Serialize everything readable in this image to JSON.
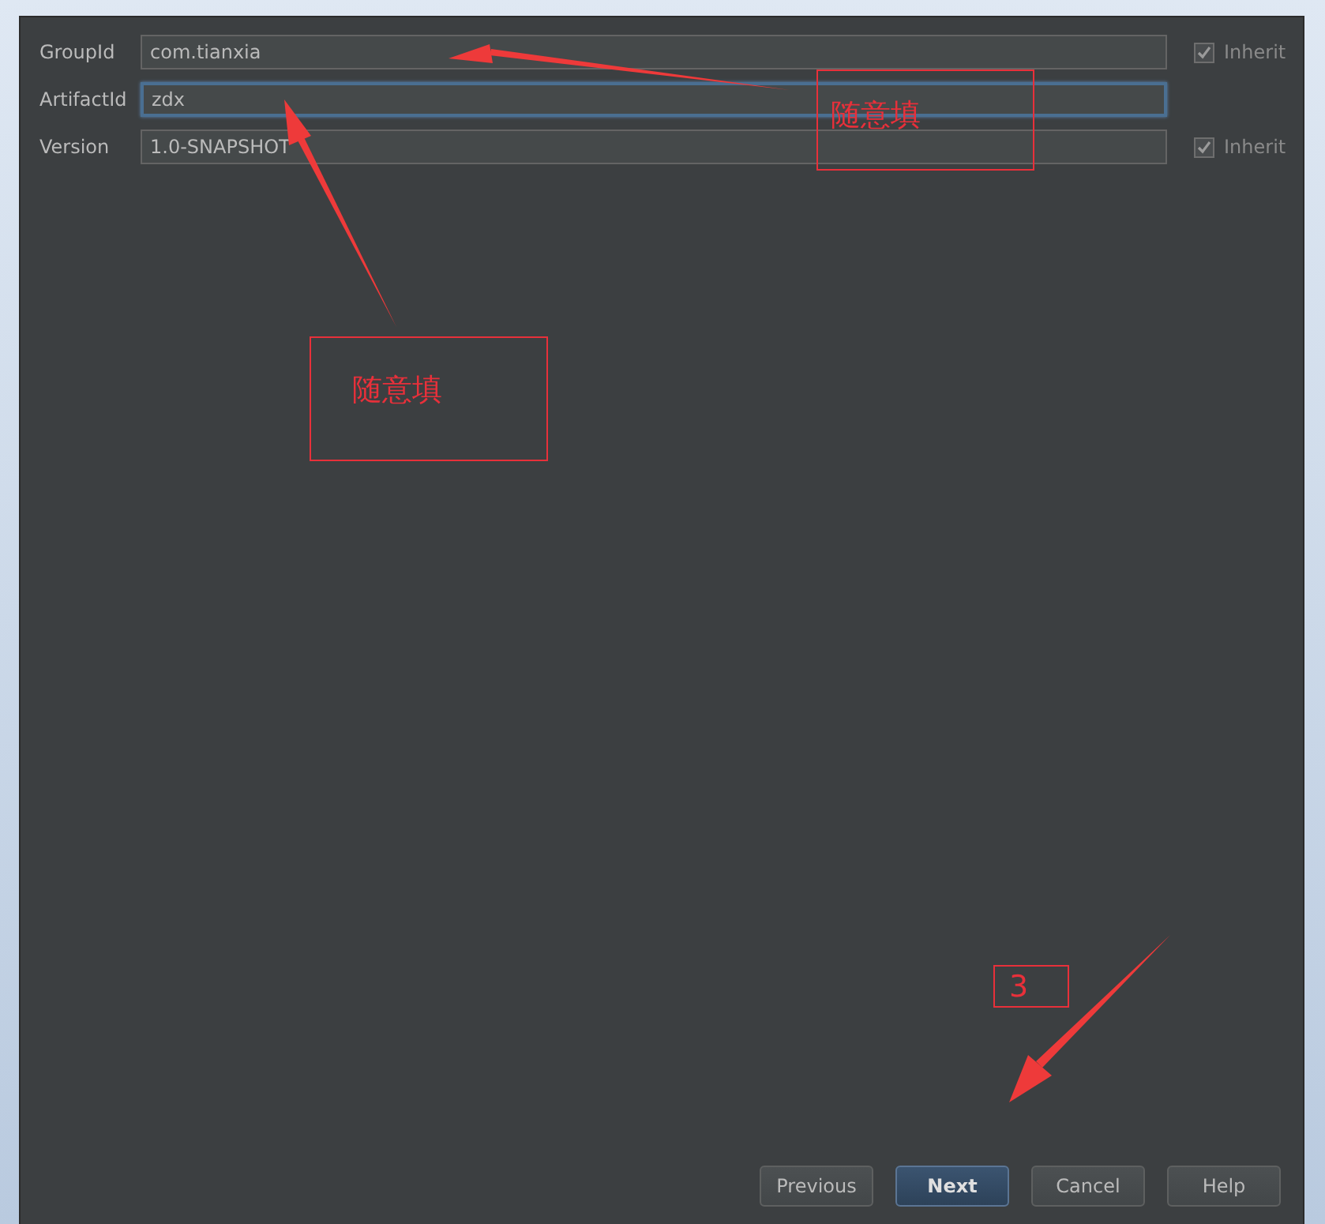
{
  "fields": [
    {
      "label": "GroupId",
      "value": "com.tianxia",
      "focused": false,
      "inherit": {
        "label": "Inherit",
        "checked": true
      }
    },
    {
      "label": "ArtifactId",
      "value": "zdx",
      "focused": true
    },
    {
      "label": "Version",
      "value": "1.0-SNAPSHOT",
      "focused": false,
      "inherit": {
        "label": "Inherit",
        "checked": true
      }
    }
  ],
  "annotations": [
    {
      "kind": "note",
      "text": "随意填"
    },
    {
      "kind": "note",
      "text": "随意填"
    },
    {
      "kind": "note",
      "text": "3"
    }
  ],
  "buttons": [
    {
      "label": "Previous",
      "default": false
    },
    {
      "label": "Next",
      "default": true
    },
    {
      "label": "Cancel",
      "default": false
    },
    {
      "label": "Help",
      "default": false
    }
  ]
}
